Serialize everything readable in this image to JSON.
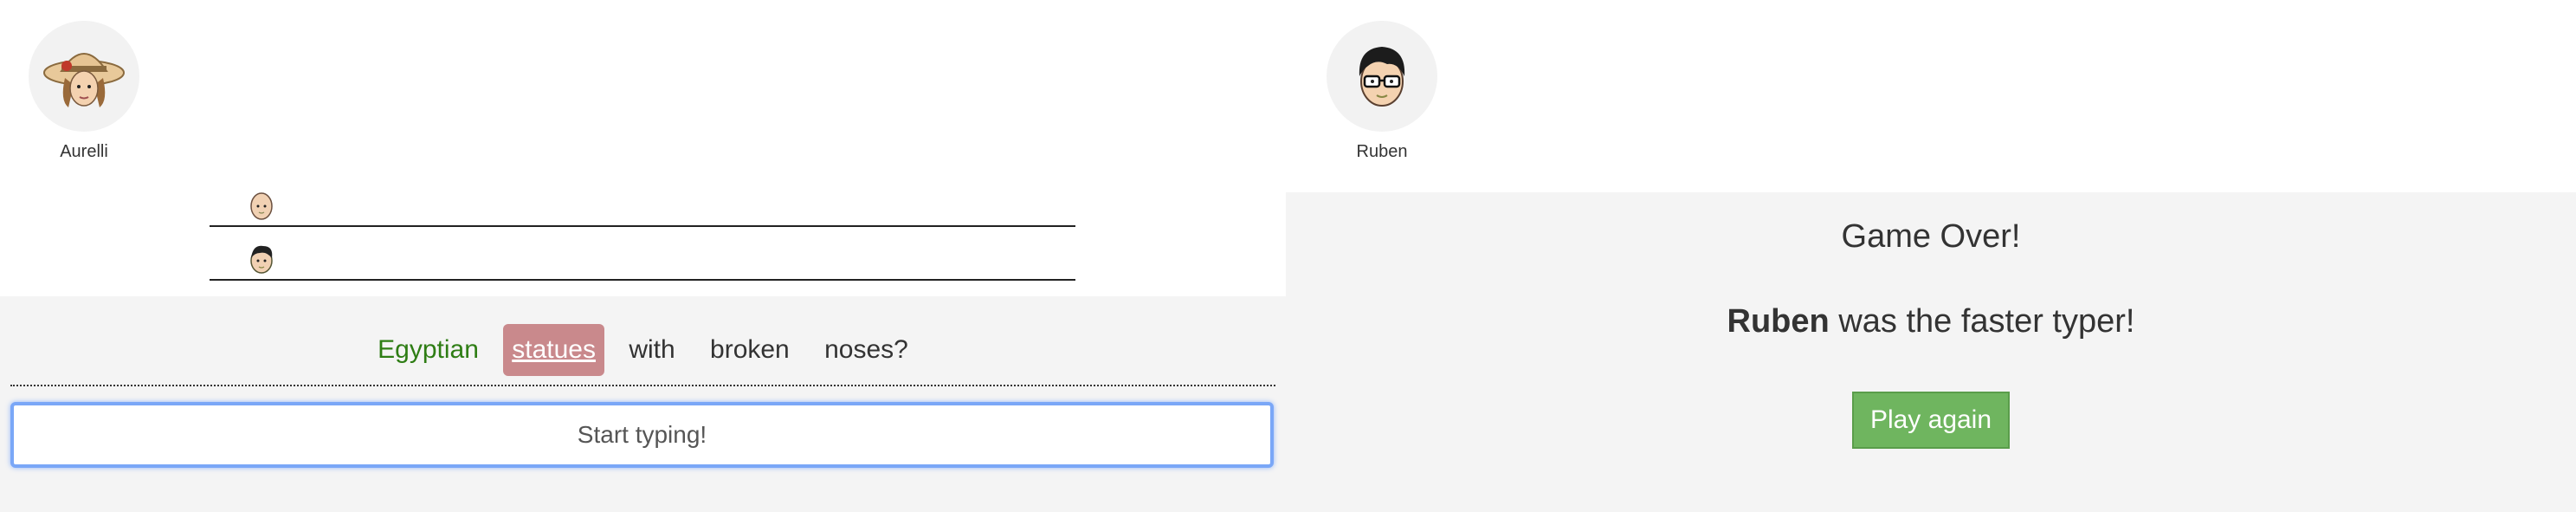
{
  "left_panel": {
    "player": {
      "name": "Aurelli",
      "avatar_icon": "sun-hat-girl-avatar-icon"
    },
    "race_lanes": [
      {
        "avatar_icon": "bald-racer-icon"
      },
      {
        "avatar_icon": "dark-hair-racer-icon"
      }
    ],
    "sentence": {
      "words": [
        {
          "text": "Egyptian",
          "state": "done"
        },
        {
          "text": "statues",
          "state": "current"
        },
        {
          "text": "with",
          "state": "pending"
        },
        {
          "text": "broken",
          "state": "pending"
        },
        {
          "text": "noses?",
          "state": "pending"
        }
      ]
    },
    "input": {
      "placeholder": "Start typing!",
      "value": ""
    }
  },
  "right_panel": {
    "player": {
      "name": "Ruben",
      "avatar_icon": "glasses-boy-avatar-icon"
    },
    "game_over": {
      "title": "Game Over!",
      "winner": "Ruben",
      "result_suffix": "was the faster typer!",
      "play_again_label": "Play again"
    }
  },
  "colors": {
    "done_word": "#2e7d14",
    "current_word_bg": "#c9898c",
    "button_bg": "#6fb55f",
    "input_focus": "#7aa7f7",
    "panel_bg": "#f4f4f4"
  }
}
